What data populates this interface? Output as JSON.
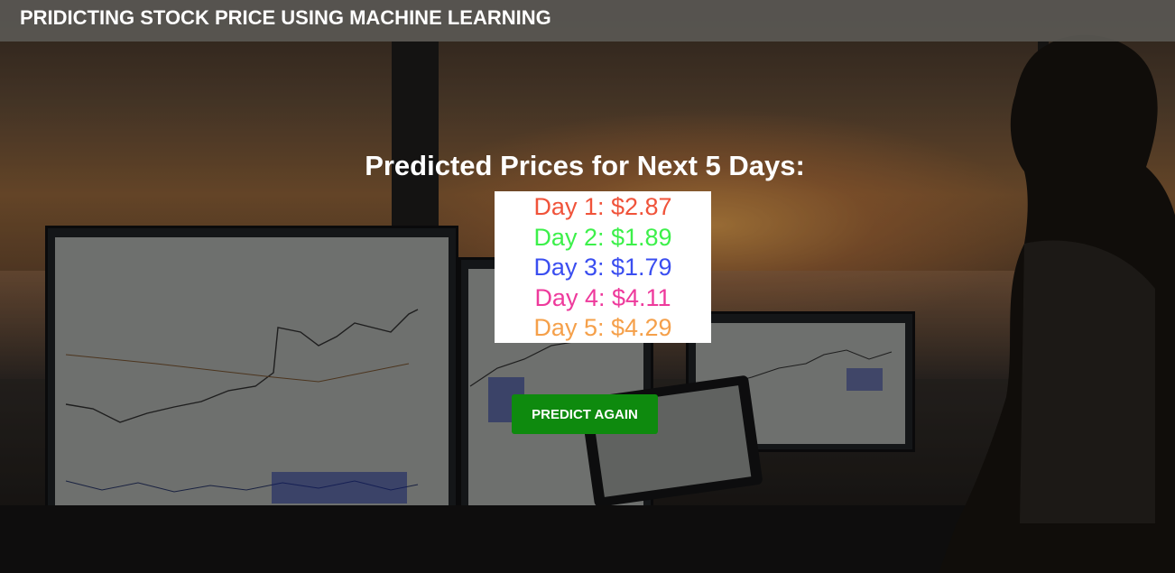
{
  "header": {
    "title": "PRIDICTING STOCK PRICE USING MACHINE LEARNING"
  },
  "results": {
    "heading": "Predicted Prices for Next 5 Days:",
    "days": [
      {
        "label": "Day 1: $2.87",
        "value": 2.87,
        "color": "#f0533a"
      },
      {
        "label": "Day 2: $1.89",
        "value": 1.89,
        "color": "#3cf04a"
      },
      {
        "label": "Day 3: $1.79",
        "value": 1.79,
        "color": "#3a4ef0"
      },
      {
        "label": "Day 4: $4.11",
        "value": 4.11,
        "color": "#ee3a9c"
      },
      {
        "label": "Day 5: $4.29",
        "value": 4.29,
        "color": "#f5a04a"
      }
    ]
  },
  "actions": {
    "predict_again_label": "PREDICT AGAIN"
  },
  "colors": {
    "header_bg": "#5a5854",
    "button_bg": "#0e8a0e",
    "box_bg": "#ffffff"
  }
}
